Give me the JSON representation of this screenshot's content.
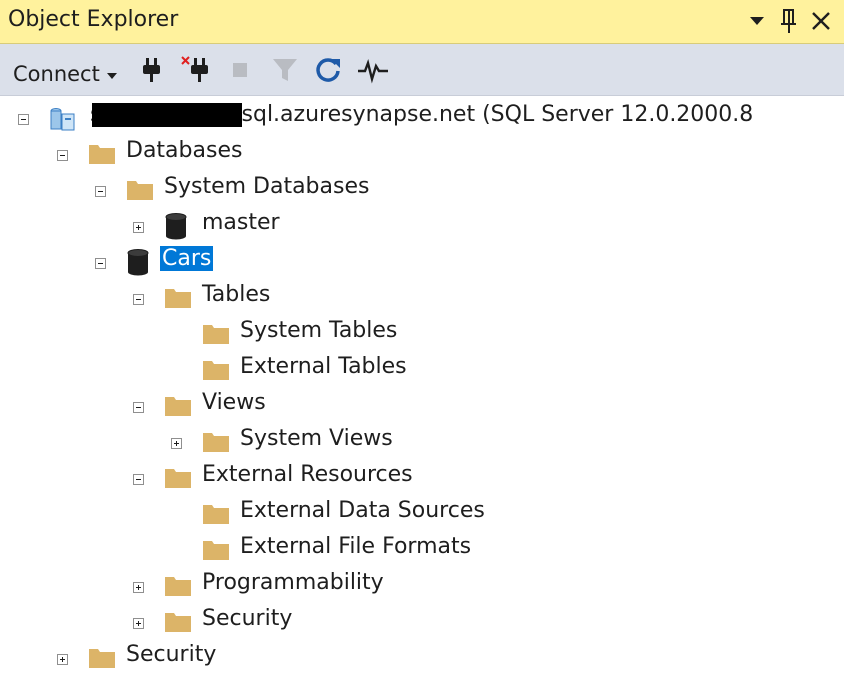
{
  "window": {
    "title": "Object Explorer",
    "controls": [
      "dropdown-arrow-icon",
      "pin-icon",
      "close-icon"
    ]
  },
  "toolbar": {
    "connect_label": "Connect",
    "tools": [
      "connect-plug-icon",
      "disconnect-icon",
      "stop-icon",
      "filter-icon",
      "refresh-icon",
      "activity-monitor-icon"
    ]
  },
  "tree": {
    "server": {
      "label": "s    -ondemand.sql.azuresynapse.net (SQL Server 12.0.2000.8",
      "expanded": true
    },
    "databases": {
      "label": "Databases",
      "expanded": true
    },
    "system_databases": {
      "label": "System Databases",
      "expanded": true
    },
    "master": {
      "label": "master",
      "expanded": false
    },
    "cars": {
      "label": "Cars",
      "expanded": true,
      "selected": true
    },
    "tables": {
      "label": "Tables",
      "expanded": true
    },
    "system_tables": {
      "label": "System Tables"
    },
    "external_tables": {
      "label": "External Tables"
    },
    "views": {
      "label": "Views",
      "expanded": true
    },
    "system_views": {
      "label": "System Views",
      "expanded": false
    },
    "external_resources": {
      "label": "External Resources",
      "expanded": true
    },
    "external_data_sources": {
      "label": "External Data Sources"
    },
    "external_file_formats": {
      "label": "External File Formats"
    },
    "programmability": {
      "label": "Programmability",
      "expanded": false
    },
    "cars_security": {
      "label": "Security",
      "expanded": false
    },
    "server_security": {
      "label": "Security",
      "expanded": false
    }
  },
  "colors": {
    "title_bar": "#fff29d",
    "toolbar": "#dbe0ea",
    "selection": "#0078d7",
    "folder": "#dcb468",
    "refresh": "#1e5aa8"
  }
}
